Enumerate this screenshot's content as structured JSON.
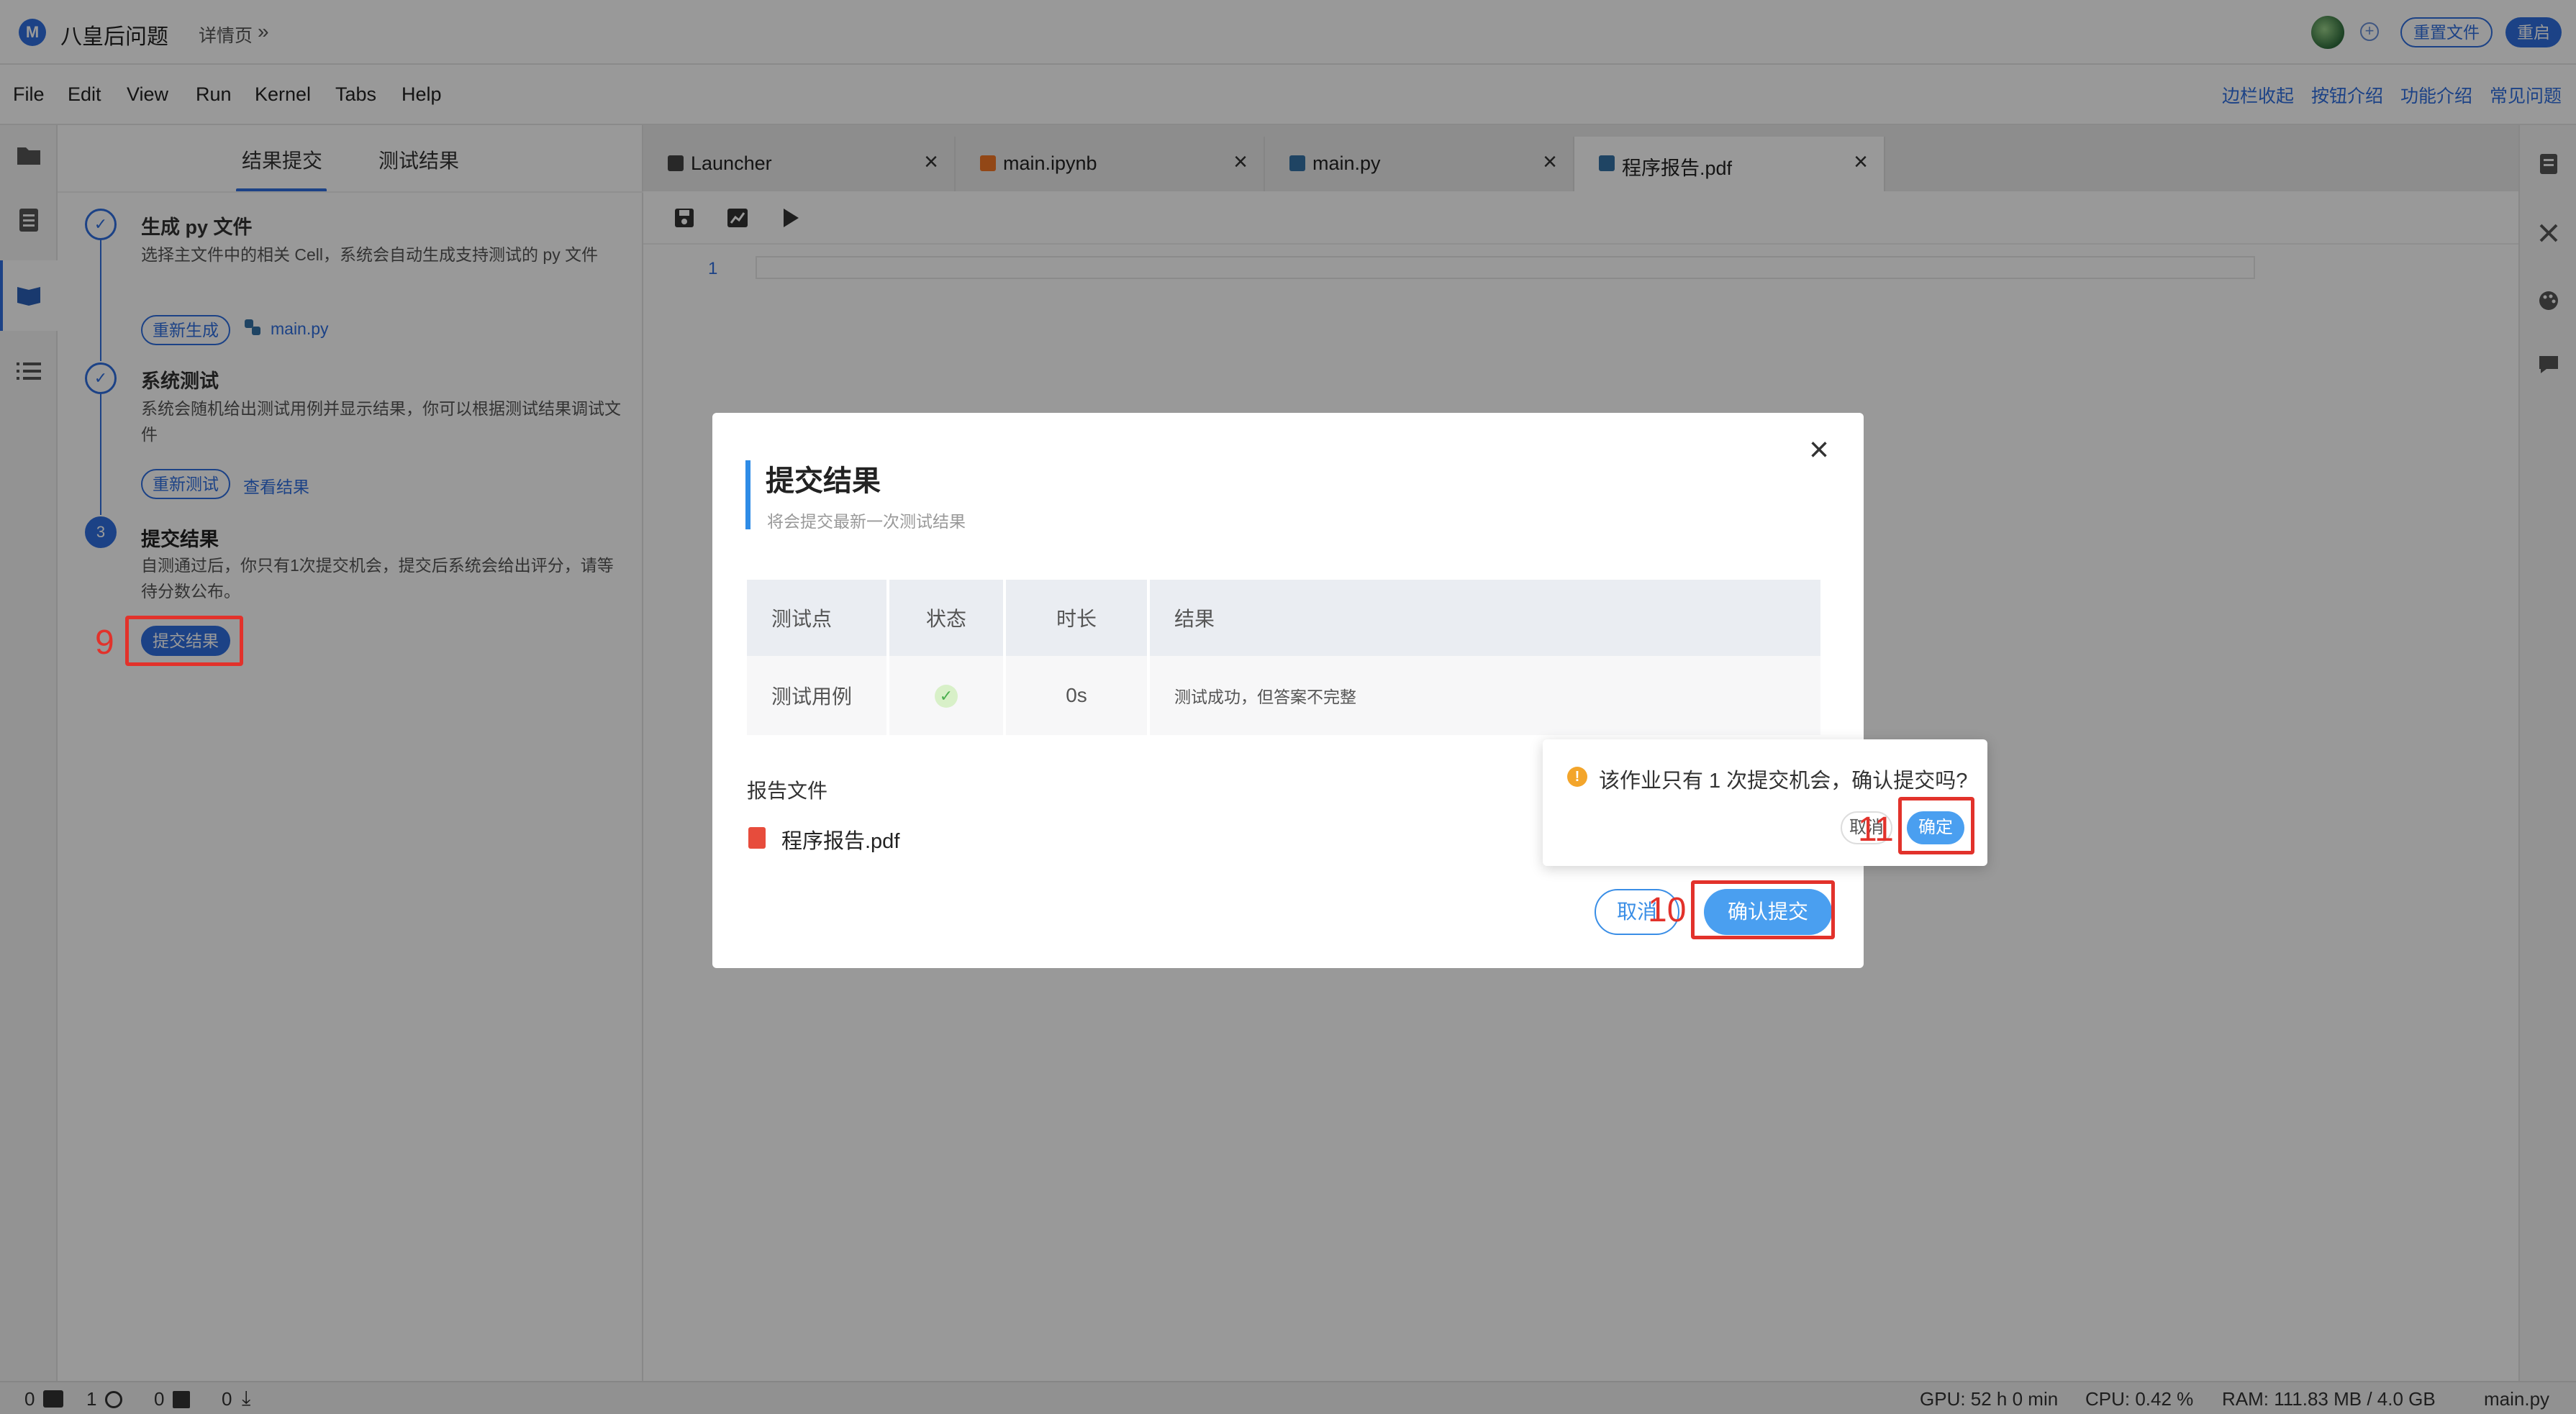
{
  "header": {
    "app_title": "八皇后问题",
    "breadcrumb": "详情页",
    "breadcrumb_chevron": "»",
    "reset_file_label": "重置文件",
    "restart_label": "重启"
  },
  "menu": {
    "items": [
      "File",
      "Edit",
      "View",
      "Run",
      "Kernel",
      "Tabs",
      "Help"
    ],
    "right_links": [
      "边栏收起",
      "按钮介绍",
      "功能介绍",
      "常见问题"
    ]
  },
  "left_panel": {
    "tabs": [
      "结果提交",
      "测试结果"
    ],
    "steps": [
      {
        "number": "✓",
        "title": "生成 py 文件",
        "desc": "选择主文件中的相关 Cell，系统会自动生成支持测试的 py 文件",
        "button": "重新生成",
        "link": "main.py"
      },
      {
        "number": "✓",
        "title": "系统测试",
        "desc": "系统会随机给出测试用例并显示结果，你可以根据测试结果调试文件",
        "button": "重新测试",
        "link": "查看结果"
      },
      {
        "number": "3",
        "title": "提交结果",
        "desc": "自测通过后，你只有1次提交机会，提交后系统会给出评分，请等待分数公布。",
        "button": "提交结果"
      }
    ]
  },
  "editor": {
    "tabs": [
      {
        "label": "Launcher",
        "icon": "launcher-icon"
      },
      {
        "label": "main.ipynb",
        "icon": "notebook-icon"
      },
      {
        "label": "main.py",
        "icon": "python-icon"
      },
      {
        "label": "程序报告.pdf",
        "icon": "python-icon",
        "active": true
      }
    ],
    "line_number": "1"
  },
  "status_bar": {
    "terminals": "0",
    "kernels": "1",
    "docs": "0",
    "downloads": "0",
    "gpu": "GPU: 52 h 0 min",
    "cpu": "CPU: 0.42 %",
    "ram": "RAM: 111.83 MB / 4.0 GB",
    "file": "main.py"
  },
  "modal": {
    "title": "提交结果",
    "subtitle": "将会提交最新一次测试结果",
    "close": "×",
    "table": {
      "headers": [
        "测试点",
        "状态",
        "时长",
        "结果"
      ],
      "rows": [
        {
          "point": "测试用例",
          "status": "✓",
          "duration": "0s",
          "result": "测试成功，但答案不完整"
        }
      ]
    },
    "report_label": "报告文件",
    "report_file": "程序报告.pdf",
    "cancel_label": "取消",
    "confirm_label": "确认提交"
  },
  "popconfirm": {
    "message": "该作业只有 1 次提交机会，确认提交吗?",
    "cancel_label": "取消",
    "ok_label": "确定"
  },
  "annotations": {
    "n9": "9",
    "n10": "10",
    "n11": "11"
  },
  "colors": {
    "accent": "#2f6fe0",
    "annotation": "#e2322b",
    "confirm_button": "#4a9ff0",
    "warning": "#f3a52b"
  }
}
